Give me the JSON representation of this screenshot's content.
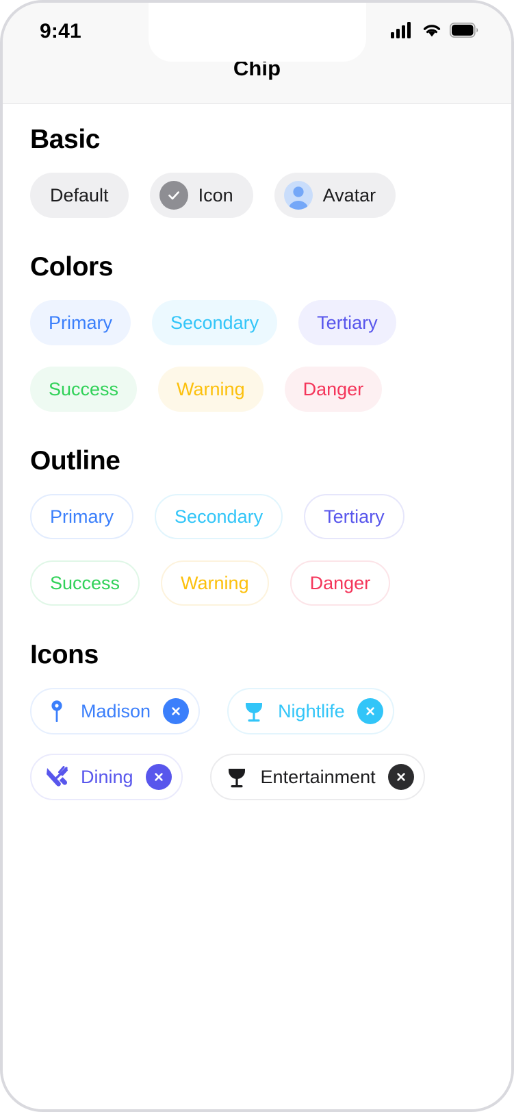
{
  "status_bar": {
    "time": "9:41",
    "cellular_icon": "signal-bars-icon",
    "wifi_icon": "wifi-icon",
    "battery_icon": "battery-icon"
  },
  "nav": {
    "title": "Chip"
  },
  "sections": {
    "basic": {
      "title": "Basic",
      "chips": [
        {
          "label": "Default",
          "icon": null
        },
        {
          "label": "Icon",
          "icon": "check-circle-icon"
        },
        {
          "label": "Avatar",
          "icon": "avatar-icon"
        }
      ]
    },
    "colors": {
      "title": "Colors",
      "chips": [
        {
          "label": "Primary",
          "bg": "#eef4ff",
          "fg": "#3b7ffb"
        },
        {
          "label": "Secondary",
          "bg": "#ecf9ff",
          "fg": "#32c5f8"
        },
        {
          "label": "Tertiary",
          "bg": "#f0f0fe",
          "fg": "#5856ec"
        },
        {
          "label": "Success",
          "bg": "#eefaf2",
          "fg": "#30d158"
        },
        {
          "label": "Warning",
          "bg": "#fef8e8",
          "fg": "#fcc00c"
        },
        {
          "label": "Danger",
          "bg": "#fdf0f2",
          "fg": "#f4355a"
        }
      ]
    },
    "outline": {
      "title": "Outline",
      "chips": [
        {
          "label": "Primary",
          "border": "#e2ecfe",
          "fg": "#3b7ffb"
        },
        {
          "label": "Secondary",
          "border": "#e1f5fd",
          "fg": "#32c5f8"
        },
        {
          "label": "Tertiary",
          "border": "#e6e6fb",
          "fg": "#5856ec"
        },
        {
          "label": "Success",
          "border": "#e0f7e7",
          "fg": "#30d158"
        },
        {
          "label": "Warning",
          "border": "#fdf3dd",
          "fg": "#fcc00c"
        },
        {
          "label": "Danger",
          "border": "#fce4e8",
          "fg": "#f4355a"
        }
      ]
    },
    "icons": {
      "title": "Icons",
      "chips": [
        {
          "label": "Madison",
          "icon": "map-pin-icon",
          "fg": "#3b7ffb",
          "border": "#e6effe",
          "delete_bg": "#3b7ffb",
          "delete_icon": "close-icon"
        },
        {
          "label": "Nightlife",
          "icon": "cocktail-icon",
          "fg": "#32c5f8",
          "border": "#e3f5fd",
          "delete_bg": "#32c5f8",
          "delete_icon": "close-icon"
        },
        {
          "label": "Dining",
          "icon": "cutlery-icon",
          "fg": "#5856ec",
          "border": "#eaeafc",
          "delete_bg": "#5856ec",
          "delete_icon": "close-icon"
        },
        {
          "label": "Entertainment",
          "icon": "wine-glass-icon",
          "fg": "#1c1c1e",
          "border": "#ebebed",
          "delete_bg": "#2c2c2e",
          "delete_icon": "close-icon"
        }
      ]
    }
  }
}
